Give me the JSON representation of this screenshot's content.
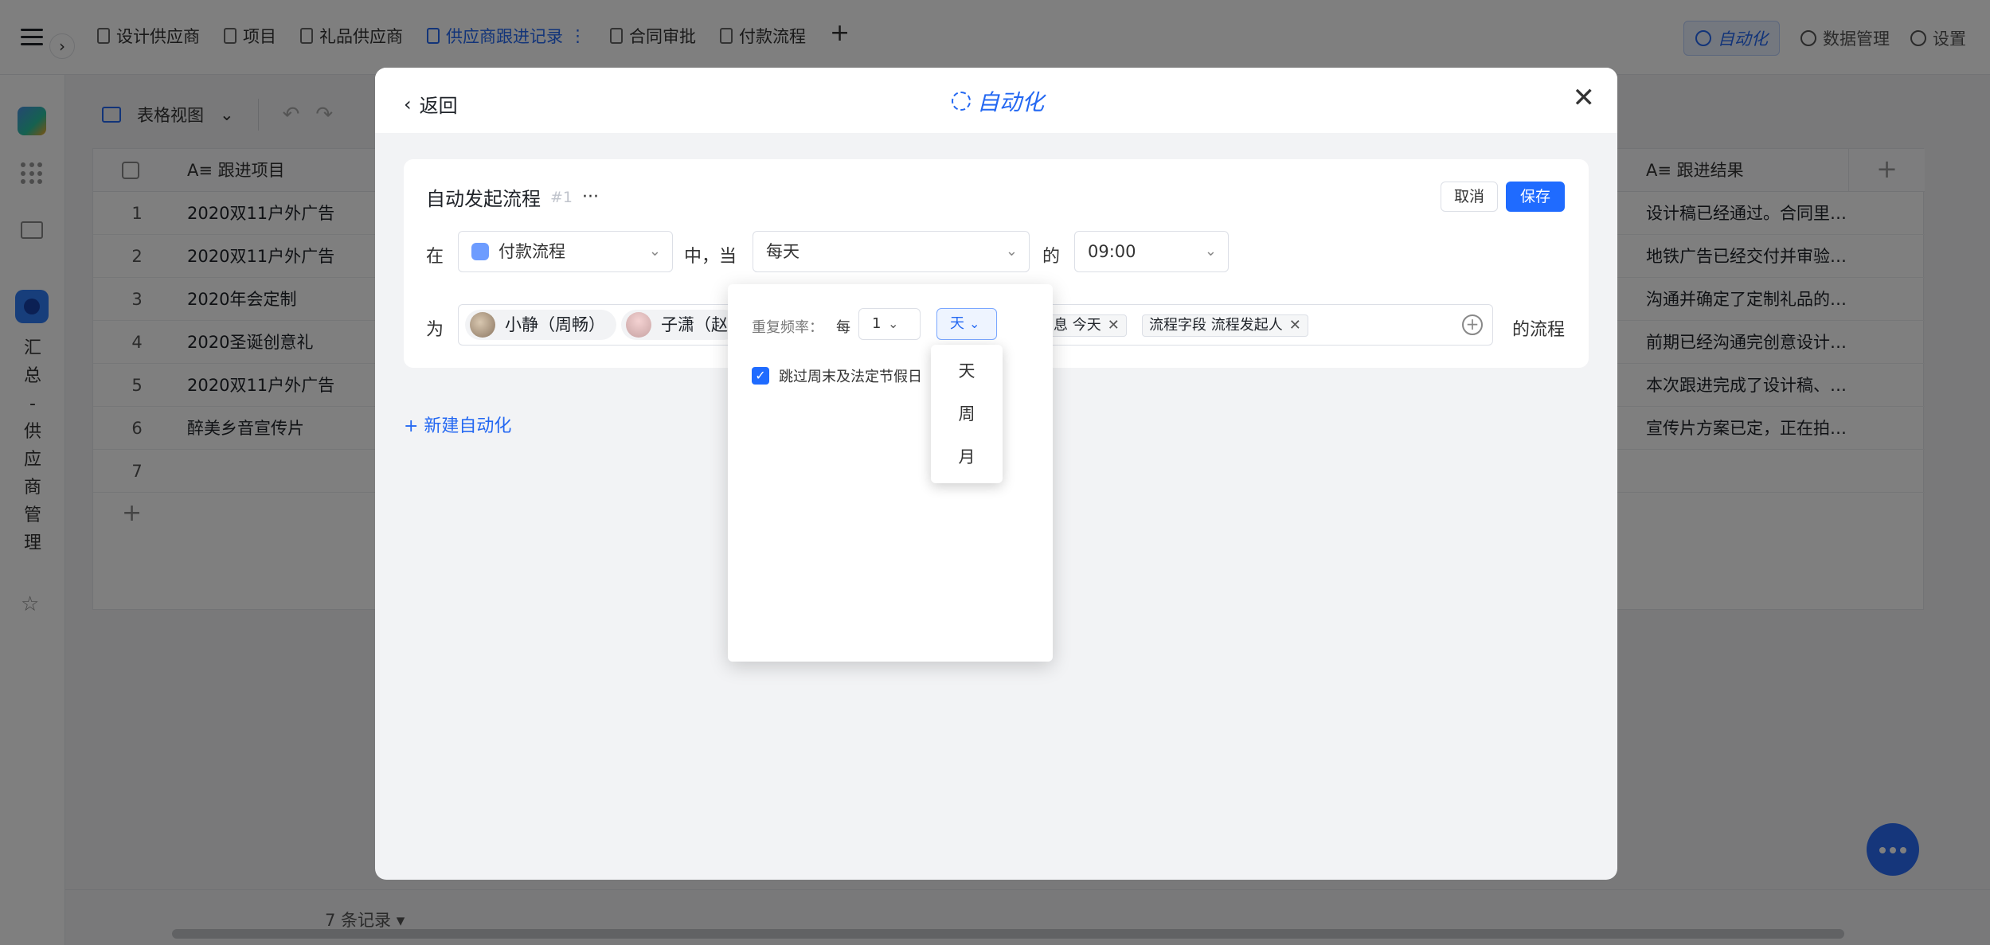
{
  "tabs": [
    "设计供应商",
    "项目",
    "礼品供应商",
    "供应商跟进记录",
    "合同审批",
    "付款流程"
  ],
  "top_right": {
    "automation": "自动化",
    "data_management": "数据管理",
    "settings": "设置"
  },
  "sidebar": {
    "app_name": [
      "汇",
      "总",
      "-",
      "供",
      "应",
      "商",
      "管",
      "理"
    ]
  },
  "toolbar": {
    "view_label": "表格视图"
  },
  "table": {
    "columns": [
      "跟进项目",
      "跟进结果"
    ],
    "rows": [
      {
        "num": "1",
        "project": "2020双11户外广告",
        "result": "设计稿已经通过。合同里…"
      },
      {
        "num": "2",
        "project": "2020双11户外广告",
        "result": "地铁广告已经交付并审验…"
      },
      {
        "num": "3",
        "project": "2020年会定制",
        "result": "沟通并确定了定制礼品的…"
      },
      {
        "num": "4",
        "project": "2020圣诞创意礼",
        "result": "前期已经沟通完创意设计…"
      },
      {
        "num": "5",
        "project": "2020双11户外广告",
        "result": "本次跟进完成了设计稿、…"
      },
      {
        "num": "6",
        "project": "醉美乡音宣传片",
        "result": "宣传片方案已定，正在拍…"
      },
      {
        "num": "7",
        "project": "",
        "result": ""
      }
    ],
    "add_row": "+"
  },
  "footer": {
    "record_count": "7 条记录 ▾"
  },
  "modal": {
    "back": "返回",
    "title": "自动化",
    "close": "✕",
    "rule": {
      "name": "自动发起流程",
      "index": "#1",
      "more": "···",
      "cancel": "取消",
      "save": "保存",
      "in_label": "在",
      "flow_value": "付款流程",
      "when_label": "中，当",
      "trigger_value": "每天",
      "of_label": "的",
      "time_value": "09:00",
      "for_label": "为",
      "people": [
        "小静（周畅）",
        "子潇（赵"
      ],
      "tags": [
        {
          "text": "息  今天"
        },
        {
          "text": "流程字段  流程发起人"
        }
      ],
      "suffix": "的流程"
    },
    "new_automation": "+ 新建自动化"
  },
  "repeat_popover": {
    "label": "重复频率：",
    "every": "每",
    "number": "1",
    "unit": "天",
    "skip_holidays": "跳过周末及法定节假日",
    "skip_checked": true,
    "unit_options": [
      "天",
      "周",
      "月"
    ]
  },
  "colors": {
    "accent": "#1f6bff",
    "link": "#2468f2"
  }
}
